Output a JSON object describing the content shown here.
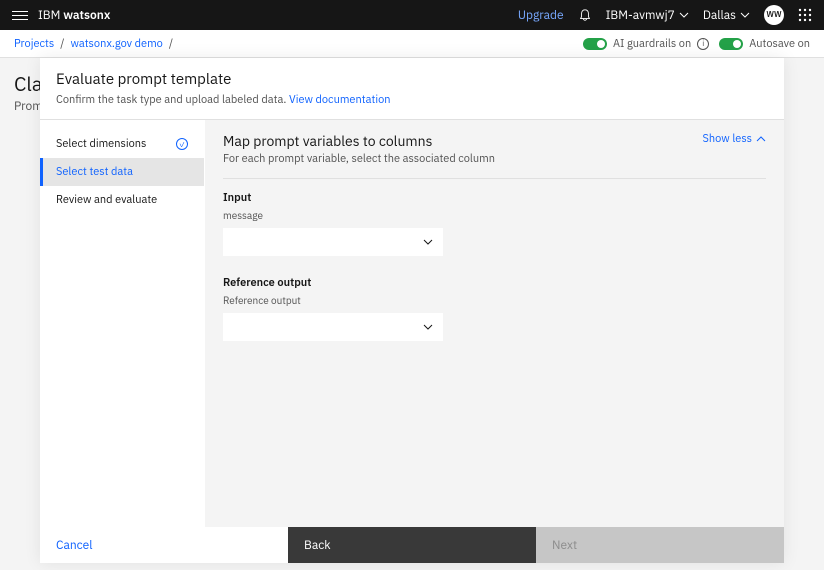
{
  "topbar": {
    "brand_prefix": "IBM ",
    "brand_bold": "watsonx",
    "upgrade": "Upgrade",
    "account": "IBM-avmwj7",
    "region": "Dallas",
    "avatar": "WW"
  },
  "subbar": {
    "crumb1": "Projects",
    "crumb2": "watsonx.gov demo",
    "guardrails": "AI guardrails on",
    "autosave": "Autosave on"
  },
  "bg": {
    "title": "Cla",
    "sub": "Prom"
  },
  "modal": {
    "title": "Evaluate prompt template",
    "sub": "Confirm the task type and upload labeled data.",
    "doclink": "View documentation"
  },
  "steps": {
    "s1": "Select dimensions",
    "s2": "Select test data",
    "s3": "Review and evaluate"
  },
  "content": {
    "title": "Map prompt variables to columns",
    "desc": "For each prompt variable, select the associated column",
    "show_less": "Show less",
    "input_heading": "Input",
    "input_field": "message",
    "ref_heading": "Reference output",
    "ref_field": "Reference output"
  },
  "footer": {
    "cancel": "Cancel",
    "back": "Back",
    "next": "Next"
  }
}
